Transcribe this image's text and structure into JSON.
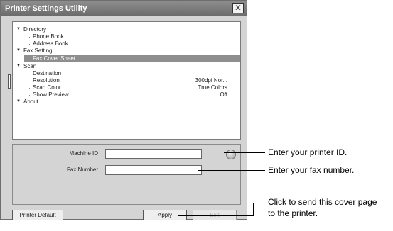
{
  "window": {
    "title": "Printer Settings Utility",
    "close_glyph": "✕"
  },
  "tree": {
    "arrow_glyph": "▼",
    "items": [
      {
        "label": "Directory",
        "value": ""
      },
      {
        "label": "Phone Book",
        "value": ""
      },
      {
        "label": "Address Book",
        "value": ""
      },
      {
        "label": "Fax Setting",
        "value": ""
      },
      {
        "label": "Fax Cover Sheet",
        "value": ""
      },
      {
        "label": "Scan",
        "value": ""
      },
      {
        "label": "Destination",
        "value": ""
      },
      {
        "label": "Resolution",
        "value": "300dpi Nor..."
      },
      {
        "label": "Scan Color",
        "value": "True Colors"
      },
      {
        "label": "Show Preview",
        "value": "Off"
      },
      {
        "label": "About",
        "value": ""
      }
    ]
  },
  "form": {
    "machine_id_label": "Machine ID",
    "machine_id_value": "",
    "fax_number_label": "Fax Number",
    "fax_number_value": ""
  },
  "buttons": {
    "printer_default": "Printer Default",
    "apply": "Apply",
    "exit": "Exit"
  },
  "callouts": {
    "machine_id": "Enter your printer ID.",
    "fax_number": "Enter your fax number.",
    "apply_line1": "Click to send this cover page",
    "apply_line2": "to the printer."
  },
  "colors": {
    "titlebar": "#7a7a7a",
    "selection": "#8e8e8e",
    "panel": "#d4d4d4"
  }
}
